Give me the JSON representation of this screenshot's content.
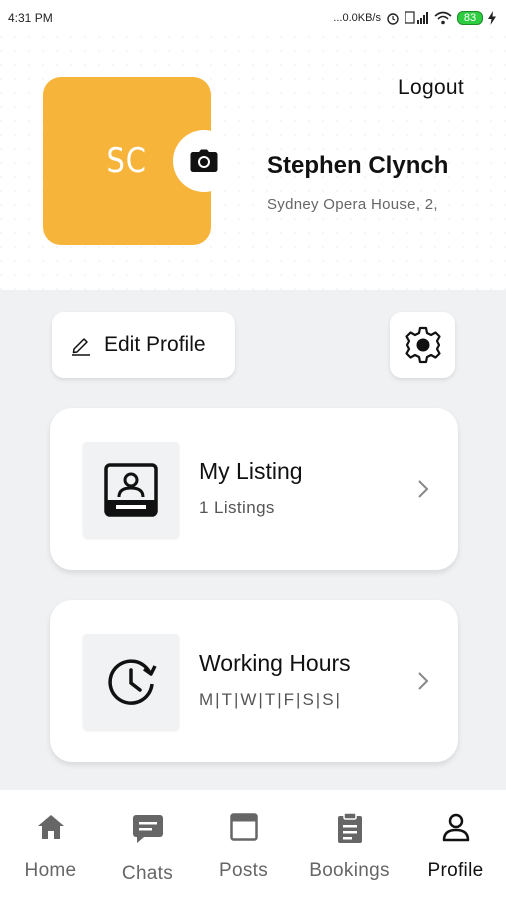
{
  "status_bar": {
    "time": "4:31 PM",
    "network_speed": "...0.0KB/s",
    "battery": "83"
  },
  "header": {
    "avatar_initials": "SC",
    "logout_label": "Logout",
    "user_name": "Stephen Clynch",
    "user_address": "Sydney Opera House, 2,"
  },
  "actions": {
    "edit_profile_label": "Edit Profile"
  },
  "cards": {
    "listing": {
      "title": "My Listing",
      "subtitle": "1 Listings"
    },
    "hours": {
      "title": "Working Hours",
      "subtitle": "M|T|W|T|F|S|S|"
    }
  },
  "nav": {
    "items": [
      {
        "label": "Home",
        "icon": "home-icon"
      },
      {
        "label": "Chats",
        "icon": "chat-icon"
      },
      {
        "label": "Posts",
        "icon": "posts-icon"
      },
      {
        "label": "Bookings",
        "icon": "bookings-icon"
      },
      {
        "label": "Profile",
        "icon": "profile-icon"
      }
    ],
    "active": "Profile"
  },
  "colors": {
    "avatar_bg": "#f7b43a",
    "content_bg": "#f0f1f3",
    "nav_inactive": "#666666",
    "nav_active": "#111111"
  }
}
